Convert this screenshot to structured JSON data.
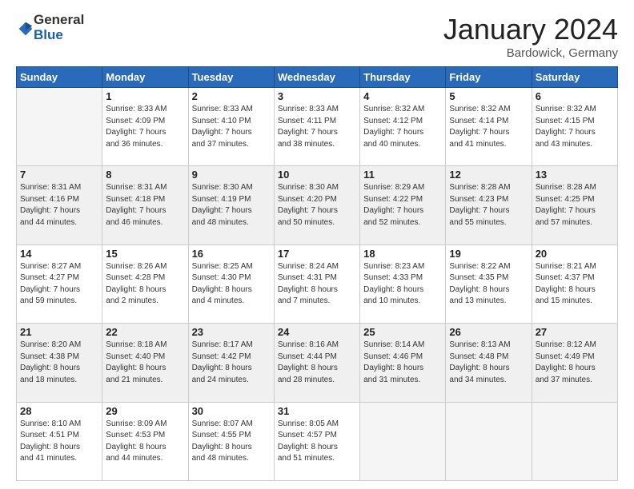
{
  "logo": {
    "general": "General",
    "blue": "Blue"
  },
  "title": "January 2024",
  "location": "Bardowick, Germany",
  "days_header": [
    "Sunday",
    "Monday",
    "Tuesday",
    "Wednesday",
    "Thursday",
    "Friday",
    "Saturday"
  ],
  "weeks": [
    [
      {
        "day": "",
        "info": ""
      },
      {
        "day": "1",
        "info": "Sunrise: 8:33 AM\nSunset: 4:09 PM\nDaylight: 7 hours\nand 36 minutes."
      },
      {
        "day": "2",
        "info": "Sunrise: 8:33 AM\nSunset: 4:10 PM\nDaylight: 7 hours\nand 37 minutes."
      },
      {
        "day": "3",
        "info": "Sunrise: 8:33 AM\nSunset: 4:11 PM\nDaylight: 7 hours\nand 38 minutes."
      },
      {
        "day": "4",
        "info": "Sunrise: 8:32 AM\nSunset: 4:12 PM\nDaylight: 7 hours\nand 40 minutes."
      },
      {
        "day": "5",
        "info": "Sunrise: 8:32 AM\nSunset: 4:14 PM\nDaylight: 7 hours\nand 41 minutes."
      },
      {
        "day": "6",
        "info": "Sunrise: 8:32 AM\nSunset: 4:15 PM\nDaylight: 7 hours\nand 43 minutes."
      }
    ],
    [
      {
        "day": "7",
        "info": "Sunrise: 8:31 AM\nSunset: 4:16 PM\nDaylight: 7 hours\nand 44 minutes."
      },
      {
        "day": "8",
        "info": "Sunrise: 8:31 AM\nSunset: 4:18 PM\nDaylight: 7 hours\nand 46 minutes."
      },
      {
        "day": "9",
        "info": "Sunrise: 8:30 AM\nSunset: 4:19 PM\nDaylight: 7 hours\nand 48 minutes."
      },
      {
        "day": "10",
        "info": "Sunrise: 8:30 AM\nSunset: 4:20 PM\nDaylight: 7 hours\nand 50 minutes."
      },
      {
        "day": "11",
        "info": "Sunrise: 8:29 AM\nSunset: 4:22 PM\nDaylight: 7 hours\nand 52 minutes."
      },
      {
        "day": "12",
        "info": "Sunrise: 8:28 AM\nSunset: 4:23 PM\nDaylight: 7 hours\nand 55 minutes."
      },
      {
        "day": "13",
        "info": "Sunrise: 8:28 AM\nSunset: 4:25 PM\nDaylight: 7 hours\nand 57 minutes."
      }
    ],
    [
      {
        "day": "14",
        "info": "Sunrise: 8:27 AM\nSunset: 4:27 PM\nDaylight: 7 hours\nand 59 minutes."
      },
      {
        "day": "15",
        "info": "Sunrise: 8:26 AM\nSunset: 4:28 PM\nDaylight: 8 hours\nand 2 minutes."
      },
      {
        "day": "16",
        "info": "Sunrise: 8:25 AM\nSunset: 4:30 PM\nDaylight: 8 hours\nand 4 minutes."
      },
      {
        "day": "17",
        "info": "Sunrise: 8:24 AM\nSunset: 4:31 PM\nDaylight: 8 hours\nand 7 minutes."
      },
      {
        "day": "18",
        "info": "Sunrise: 8:23 AM\nSunset: 4:33 PM\nDaylight: 8 hours\nand 10 minutes."
      },
      {
        "day": "19",
        "info": "Sunrise: 8:22 AM\nSunset: 4:35 PM\nDaylight: 8 hours\nand 13 minutes."
      },
      {
        "day": "20",
        "info": "Sunrise: 8:21 AM\nSunset: 4:37 PM\nDaylight: 8 hours\nand 15 minutes."
      }
    ],
    [
      {
        "day": "21",
        "info": "Sunrise: 8:20 AM\nSunset: 4:38 PM\nDaylight: 8 hours\nand 18 minutes."
      },
      {
        "day": "22",
        "info": "Sunrise: 8:18 AM\nSunset: 4:40 PM\nDaylight: 8 hours\nand 21 minutes."
      },
      {
        "day": "23",
        "info": "Sunrise: 8:17 AM\nSunset: 4:42 PM\nDaylight: 8 hours\nand 24 minutes."
      },
      {
        "day": "24",
        "info": "Sunrise: 8:16 AM\nSunset: 4:44 PM\nDaylight: 8 hours\nand 28 minutes."
      },
      {
        "day": "25",
        "info": "Sunrise: 8:14 AM\nSunset: 4:46 PM\nDaylight: 8 hours\nand 31 minutes."
      },
      {
        "day": "26",
        "info": "Sunrise: 8:13 AM\nSunset: 4:48 PM\nDaylight: 8 hours\nand 34 minutes."
      },
      {
        "day": "27",
        "info": "Sunrise: 8:12 AM\nSunset: 4:49 PM\nDaylight: 8 hours\nand 37 minutes."
      }
    ],
    [
      {
        "day": "28",
        "info": "Sunrise: 8:10 AM\nSunset: 4:51 PM\nDaylight: 8 hours\nand 41 minutes."
      },
      {
        "day": "29",
        "info": "Sunrise: 8:09 AM\nSunset: 4:53 PM\nDaylight: 8 hours\nand 44 minutes."
      },
      {
        "day": "30",
        "info": "Sunrise: 8:07 AM\nSunset: 4:55 PM\nDaylight: 8 hours\nand 48 minutes."
      },
      {
        "day": "31",
        "info": "Sunrise: 8:05 AM\nSunset: 4:57 PM\nDaylight: 8 hours\nand 51 minutes."
      },
      {
        "day": "",
        "info": ""
      },
      {
        "day": "",
        "info": ""
      },
      {
        "day": "",
        "info": ""
      }
    ]
  ]
}
